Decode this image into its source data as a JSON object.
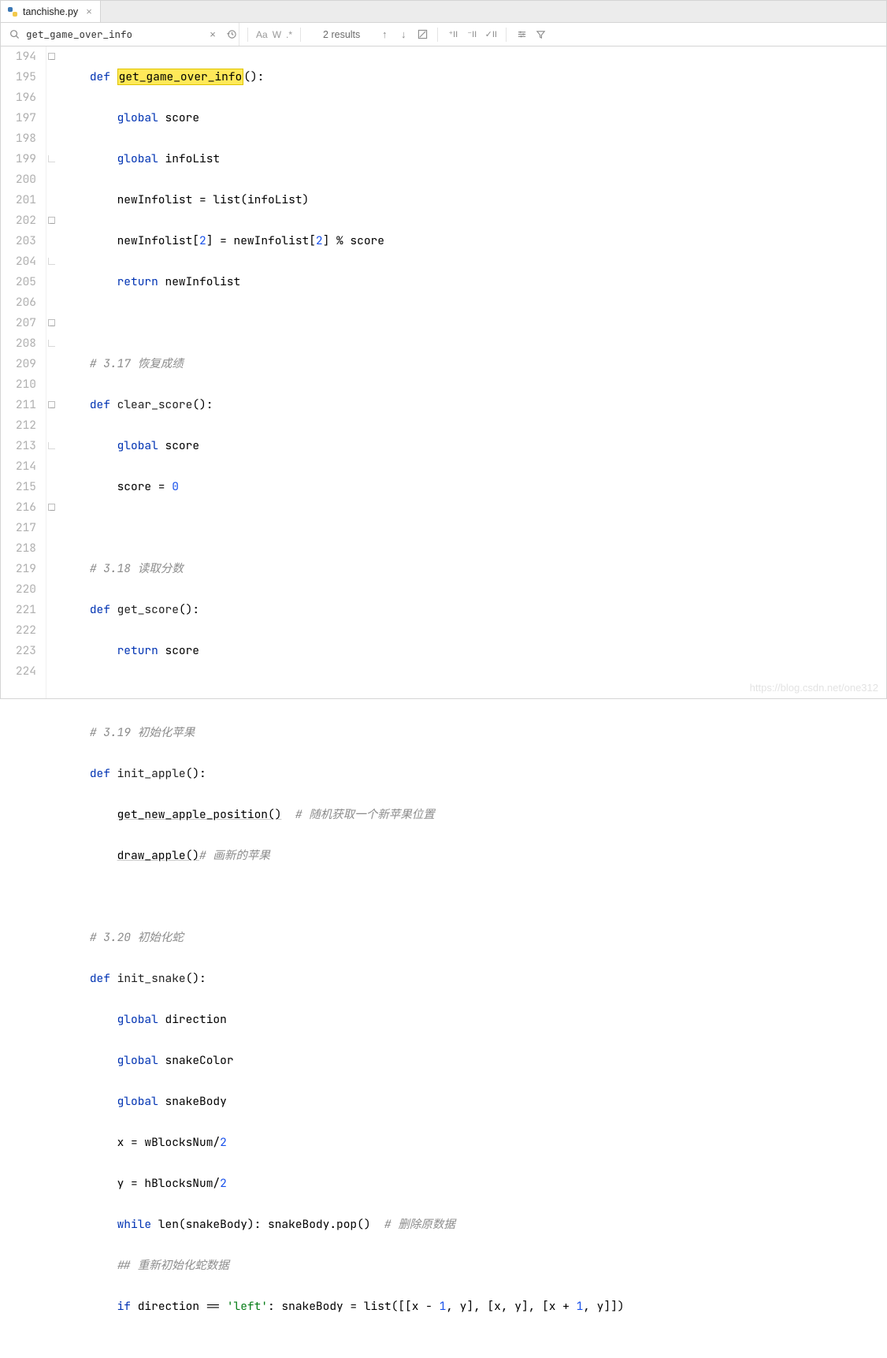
{
  "tab": {
    "filename": "tanchishe.py",
    "icon": "python-file-icon"
  },
  "find": {
    "query": "get_game_over_info",
    "results_label": "2 results",
    "match_case_label": "Aa",
    "words_label": "W",
    "regex_label": ".*"
  },
  "watermark": "https://blog.csdn.net/one312",
  "gutter": {
    "start": 194,
    "end": 224
  },
  "code": {
    "l194": {
      "def": "def",
      "name": "get_game_over_info",
      "tail": "():"
    },
    "l195": {
      "global": "global",
      "var": "score"
    },
    "l196": {
      "global": "global",
      "var": "infoList"
    },
    "l197": {
      "lhs": "newInfolist",
      "eq": " = ",
      "fn": "list",
      "arg": "infoList",
      "close": ")"
    },
    "l198": {
      "a": "newInfolist[",
      "i1": "2",
      "b": "] = newInfolist[",
      "i2": "2",
      "c": "] % score"
    },
    "l199": {
      "ret": "return",
      "val": " newInfolist"
    },
    "l201": {
      "cm": "# 3.17 恢复成绩"
    },
    "l202": {
      "def": "def",
      "name": "clear_score",
      "tail": "():"
    },
    "l203": {
      "global": "global",
      "var": "score"
    },
    "l204": {
      "a": "score = ",
      "n": "0"
    },
    "l206": {
      "cm": "# 3.18 读取分数"
    },
    "l207": {
      "def": "def",
      "name": "get_score",
      "tail": "():"
    },
    "l208": {
      "ret": "return",
      "val": " score"
    },
    "l210": {
      "cm": "# 3.19 初始化苹果"
    },
    "l211": {
      "def": "def",
      "name": "init_apple",
      "tail": "():"
    },
    "l212": {
      "call": "get_new_apple_position()",
      "cm": "  # 随机获取一个新苹果位置"
    },
    "l213": {
      "call": "draw_apple()",
      "cm": "# 画新的苹果"
    },
    "l215": {
      "cm": "# 3.20 初始化蛇"
    },
    "l216": {
      "def": "def",
      "name": "init_snake",
      "tail": "():"
    },
    "l217": {
      "global": "global",
      "var": "direction"
    },
    "l218": {
      "global": "global",
      "var": "snakeColor"
    },
    "l219": {
      "global": "global",
      "var": "snakeBody"
    },
    "l220": {
      "a": "x = wBlocksNum/",
      "n": "2"
    },
    "l221": {
      "a": "y = hBlocksNum/",
      "n": "2"
    },
    "l222": {
      "kw": "while",
      "a": " ",
      "fn": "len",
      "b": "(snakeBody): snakeBody.pop()",
      "cm": "  # 删除原数据"
    },
    "l223": {
      "cm": "## 重新初始化蛇数据"
    },
    "l224": {
      "kw": "if",
      "a": " direction == ",
      "s": "'left'",
      "b": ": snakeBody = ",
      "fn": "list",
      "c": "([[x - ",
      "n1": "1",
      "d": ", y], [x, y], [x + ",
      "n2": "1",
      "e": ", y]])"
    }
  }
}
